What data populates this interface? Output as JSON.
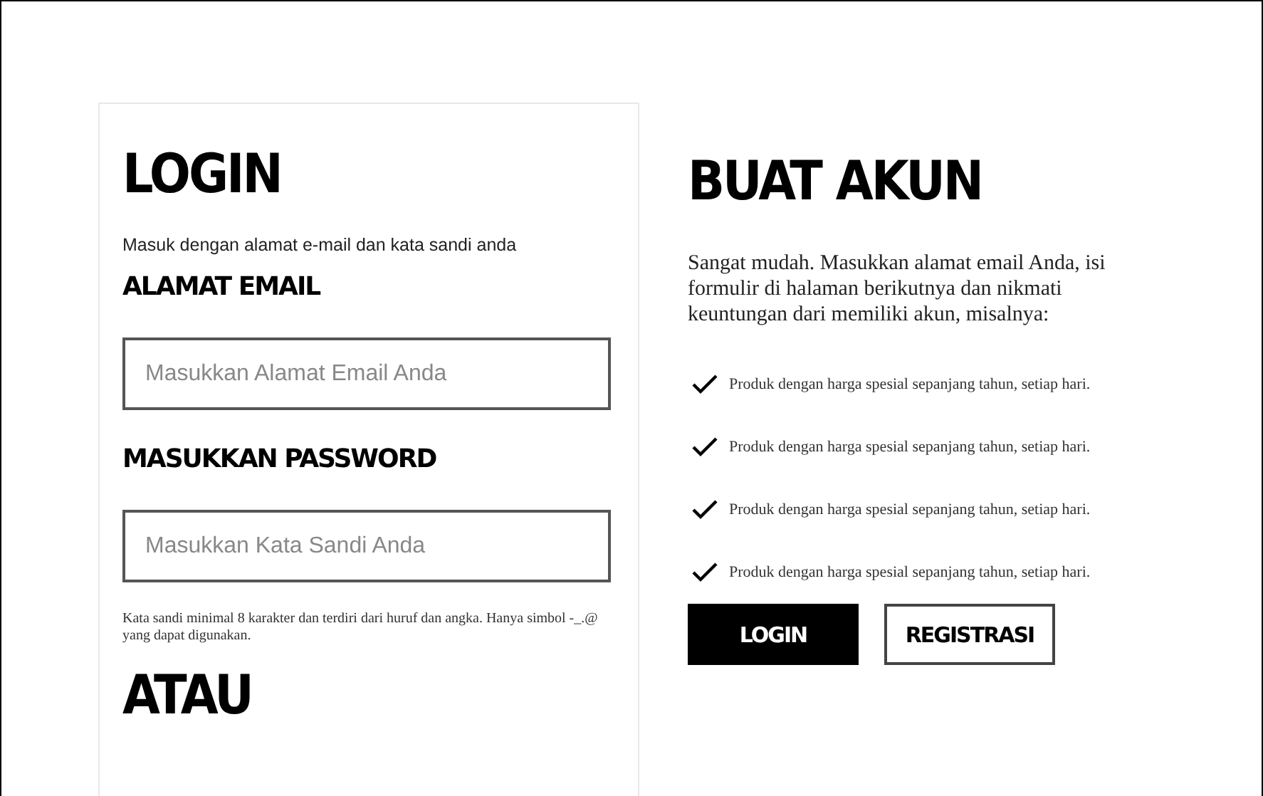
{
  "login": {
    "title": "LOGIN",
    "intro": "Masuk dengan alamat e-mail dan kata sandi anda",
    "email_label": "ALAMAT EMAIL",
    "email": {
      "placeholder": "Masukkan Alamat Email Anda"
    },
    "password_label": "MASUKKAN PASSWORD",
    "password": {
      "placeholder": "Masukkan Kata Sandi Anda"
    },
    "password_hint": "Kata sandi minimal 8 karakter dan terdiri dari huruf dan angka. Hanya simbol -_.@ yang dapat digunakan.",
    "or_heading": "ATAU"
  },
  "signup": {
    "title": "BUAT AKUN",
    "description": "Sangat mudah. Masukkan alamat email Anda, isi formulir di halaman berikutnya dan nikmati keuntungan dari memiliki akun, misalnya:",
    "benefits": [
      "Produk dengan harga spesial sepanjang tahun, setiap hari.",
      "Produk dengan harga spesial sepanjang tahun, setiap hari.",
      "Produk dengan harga spesial sepanjang tahun, setiap hari.",
      "Produk dengan harga spesial sepanjang tahun, setiap hari."
    ],
    "buttons": [
      {
        "label": "LOGIN",
        "kind": "primary"
      },
      {
        "label": "REGISTRASI",
        "kind": "secondary"
      }
    ]
  }
}
